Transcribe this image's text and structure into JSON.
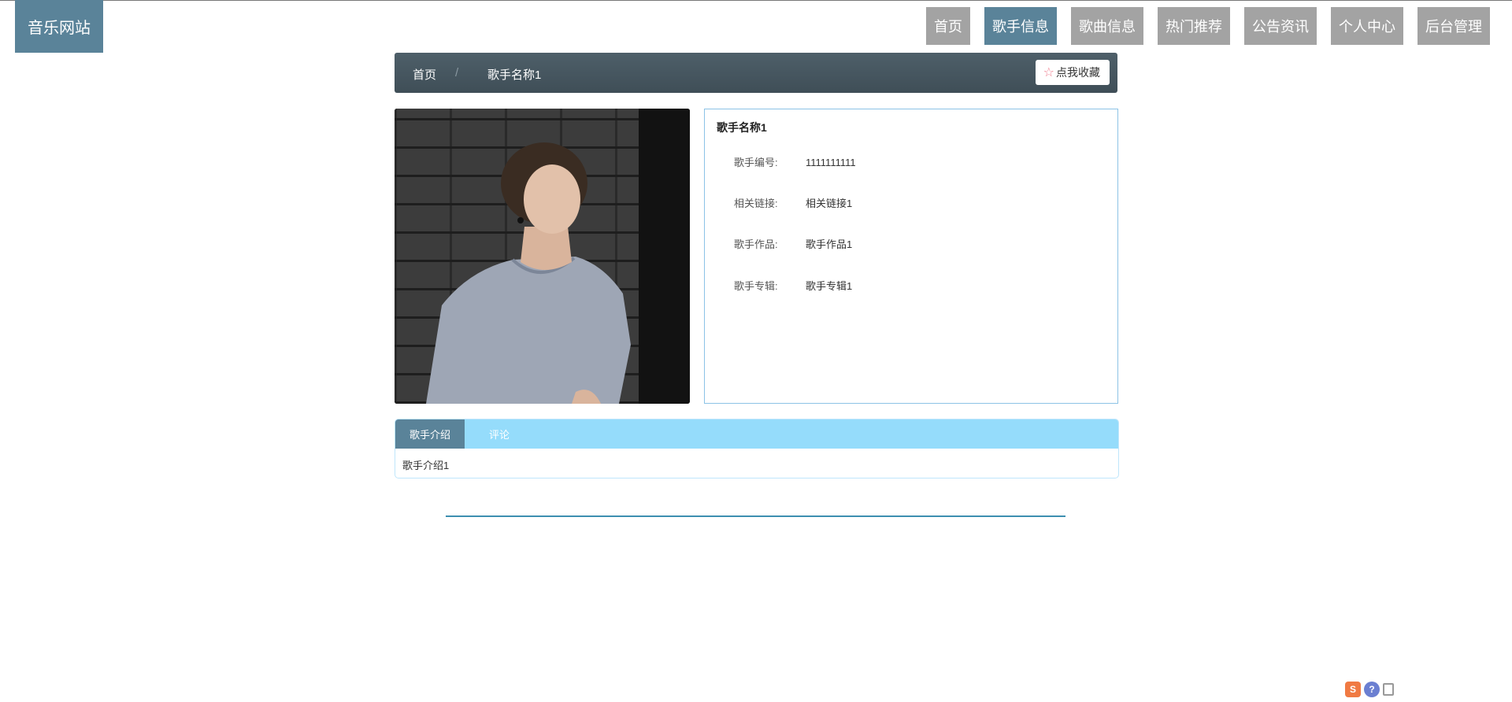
{
  "header": {
    "logo": "音乐网站",
    "nav": [
      {
        "label": "首页",
        "active": false
      },
      {
        "label": "歌手信息",
        "active": true
      },
      {
        "label": "歌曲信息",
        "active": false
      },
      {
        "label": "热门推荐",
        "active": false
      },
      {
        "label": "公告资讯",
        "active": false
      },
      {
        "label": "个人中心",
        "active": false
      },
      {
        "label": "后台管理",
        "active": false
      }
    ]
  },
  "breadcrumb": {
    "home": "首页",
    "separator": "/",
    "current": "歌手名称1",
    "favorite_label": "点我收藏"
  },
  "singer": {
    "name": "歌手名称1",
    "fields": [
      {
        "label": "歌手编号:",
        "value": "1111111111"
      },
      {
        "label": "相关链接:",
        "value": "相关链接1"
      },
      {
        "label": "歌手作品:",
        "value": "歌手作品1"
      },
      {
        "label": "歌手专辑:",
        "value": "歌手专辑1"
      }
    ]
  },
  "tabs": {
    "items": [
      {
        "label": "歌手介绍",
        "active": true
      },
      {
        "label": "评论",
        "active": false
      }
    ],
    "content": "歌手介绍1"
  },
  "tray": {
    "icons": [
      "sogou-s-icon",
      "help-icon",
      "fullscreen-icon"
    ],
    "s_glyph": "S",
    "q_glyph": "?"
  },
  "colors": {
    "accent": "#5a8399",
    "nav_inactive": "#a3a3a3",
    "tab_bar": "#95dcfb",
    "info_border": "#8cc3e6"
  }
}
